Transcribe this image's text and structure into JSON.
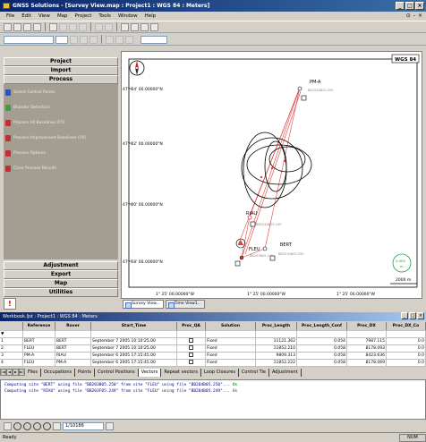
{
  "window": {
    "title": "GNSS Solutions - [Survey View.map : Project1 : WGS 84 : Meters]"
  },
  "menu": [
    "File",
    "Edit",
    "View",
    "Map",
    "Project",
    "Tools",
    "Window",
    "Help"
  ],
  "sidebar": {
    "top_sections": [
      "Project",
      "Import",
      "Process"
    ],
    "process_items": [
      {
        "label": "Select Control Points",
        "color": "#3050c0"
      },
      {
        "label": "Blunder Detection",
        "color": "#40a040"
      },
      {
        "label": "Process All Baselines (F5)",
        "color": "#c03030"
      },
      {
        "label": "Process Unprocessed Baselines (F6)",
        "color": "#c03030"
      },
      {
        "label": "Process Options",
        "color": "#c03030"
      },
      {
        "label": "Clear Process Results",
        "color": "#c03030"
      }
    ],
    "bottom_sections": [
      "Adjustment",
      "Export",
      "Map",
      "Utilities"
    ],
    "footer_icon": "!"
  },
  "map": {
    "datum_label": "WGS 84",
    "lat_labels": [
      "47° 24' 00.00000\"N",
      "47° 22' 00.00000\"N",
      "47° 20' 00.00000\"N",
      "47° 18' 00.00000\"N"
    ],
    "lon_labels": [
      "1° 25' 00.00000\"W",
      "1° 25' 00.00000\"W",
      "1° 25' 00.00000\"W"
    ],
    "sites": {
      "pma": {
        "name": "PM-A",
        "sub": "BB2S4AB04.250"
      },
      "riau": {
        "name": "RIAU",
        "sub": "BB2S4AB05.249"
      },
      "bert": {
        "name": "BERT",
        "sub": ""
      },
      "fleu": {
        "name": "FLEU",
        "sub": "BB203B05.249"
      },
      "fleu2": {
        "sub": "BB203AB05.250"
      }
    },
    "scale_label": "2000 m",
    "gauge_value": "0.009",
    "gauge_unit": "m",
    "tabs": [
      "Survey View...",
      "Time View1..."
    ]
  },
  "workbook": {
    "title": "Workbook.ljst : Project1 : WGS 84 : Meters",
    "columns": [
      "Reference",
      "Rover",
      "Start_Time",
      "Proc_QA",
      "Solution",
      "Proc_Length",
      "Proc_Length_Conf",
      "Proc_DX",
      "Proc_DX_Co"
    ],
    "rows": [
      {
        "id": "1",
        "ref": "BERT",
        "rover": "BERT",
        "start": "September 7 2005 10:10:25.00",
        "sol": "Fixed",
        "len": "11121.362",
        "conf": "0.054",
        "dx": "7987.115",
        "dxc": "0.0"
      },
      {
        "id": "2",
        "ref": "FLEU",
        "rover": "BERT",
        "start": "September 7 2005 10:10:25.00",
        "sol": "Fixed",
        "len": "11852.210",
        "conf": "0.058",
        "dx": "8178.093",
        "dxc": "0.0"
      },
      {
        "id": "3",
        "ref": "PM-A",
        "rover": "RIAU",
        "start": "September 6 2005 17:15:45.00",
        "sol": "Fixed",
        "len": "9809.313",
        "conf": "0.058",
        "dx": "8423.636",
        "dxc": "0.0"
      },
      {
        "id": "4",
        "ref": "FLEU",
        "rover": "PM-A",
        "start": "September 6 2005 17:15:45.00",
        "sol": "Fixed",
        "len": "11852.222",
        "conf": "0.058",
        "dx": "8178.069",
        "dxc": "0.0"
      }
    ],
    "sheet_tabs": [
      "Files",
      "Occupations",
      "Points",
      "Control Positions",
      "Vectors",
      "Repeat vectors",
      "Loop Closures",
      "Control Tie",
      "Adjustment"
    ]
  },
  "console": {
    "lines": [
      {
        "text": "Computing site \"BERT\" using file \"BB203B05.250\" from site \"FLEU\" using file \"BB204B05.250\"...",
        "status": " Ok"
      },
      {
        "text": "Computing site \"RIAU\" using file \"BB203F05.249\" from site \"FLEU\" using file \"BB204B05.249\"...",
        "status": " Ok"
      }
    ]
  },
  "bottom_toolbar": {
    "page_value": "1/10186"
  },
  "status": {
    "left": "Ready",
    "right": "NUM"
  }
}
